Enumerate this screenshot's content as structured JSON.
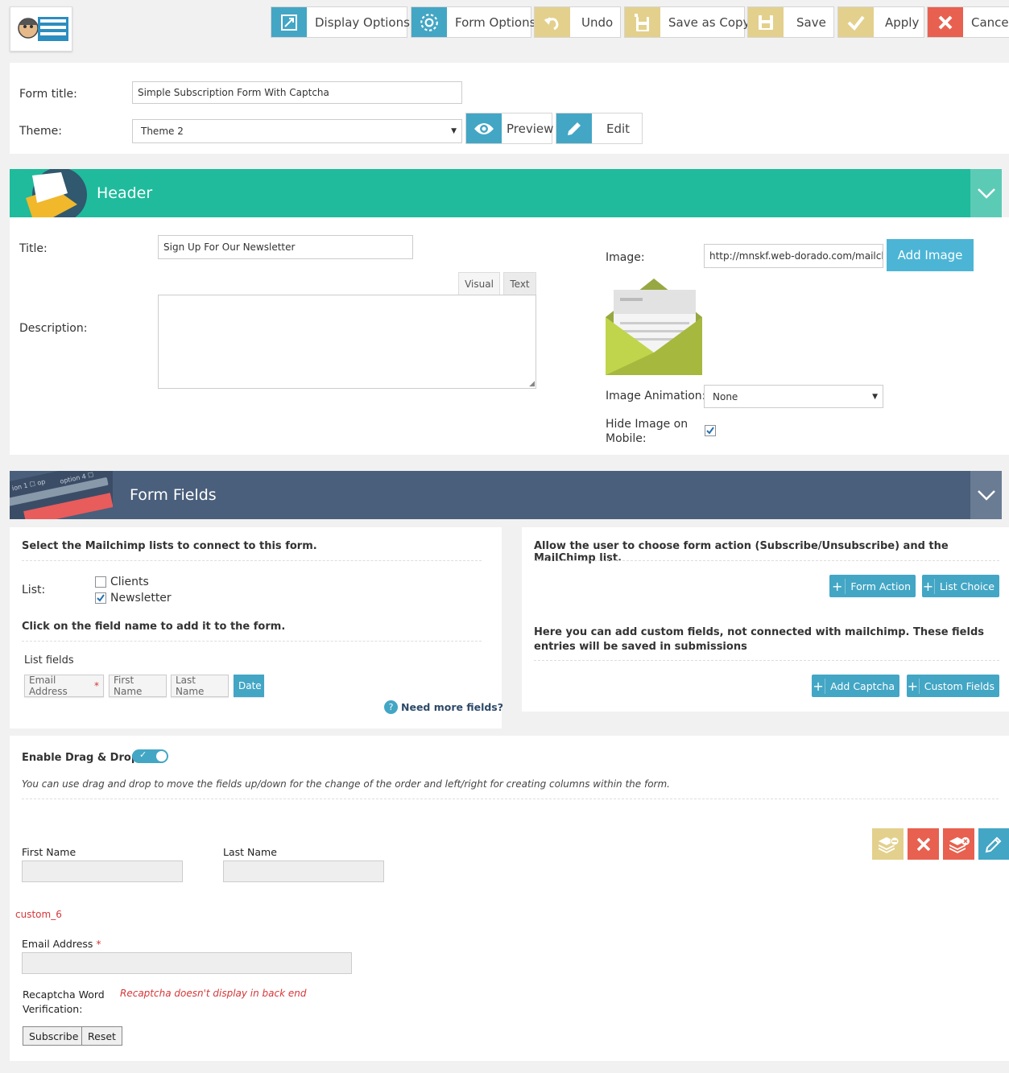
{
  "toolbar": {
    "display_options": "Display Options",
    "form_options": "Form Options",
    "undo": "Undo",
    "save_copy": "Save as Copy",
    "save": "Save",
    "apply": "Apply",
    "cancel": "Cancel"
  },
  "general": {
    "form_title_label": "Form title:",
    "form_title_value": "Simple Subscription Form With Captcha",
    "theme_label": "Theme:",
    "theme_value": "Theme 2",
    "preview": "Preview",
    "edit": "Edit"
  },
  "header_section": {
    "heading": "Header",
    "title_label": "Title:",
    "title_value": "Sign Up For Our Newsletter",
    "tab_visual": "Visual",
    "tab_text": "Text",
    "description_label": "Description:",
    "image_label": "Image:",
    "image_url": "http://mnskf.web-dorado.com/mailcl",
    "add_image": "Add Image",
    "animation_label": "Image Animation:",
    "animation_value": "None",
    "hide_label": "Hide Image on Mobile:",
    "hide_checked": true
  },
  "fields_section": {
    "heading": "Form Fields",
    "select_lists_text": "Select the Mailchimp lists to connect to this form.",
    "list_label": "List:",
    "lists": [
      {
        "name": "Clients",
        "checked": false
      },
      {
        "name": "Newsletter",
        "checked": true
      }
    ],
    "click_field_text": "Click on the field name to add it to the form.",
    "list_fields_label": "List fields",
    "chips": {
      "email": "Email Address",
      "first": "First Name",
      "last": "Last Name",
      "date": "Date"
    },
    "required_mark": "*",
    "need_more": "Need more fields?",
    "help_glyph": "?",
    "allow_user_text": "Allow the user to choose form action (Subscribe/Unsubscribe) and the MailChimp list.",
    "form_action": "Form Action",
    "list_choice": "List Choice",
    "custom_fields_text": "Here you can add custom fields, not connected with mailchimp. These fields entries will be saved in submissions",
    "add_captcha": "Add Captcha",
    "custom_fields": "Custom Fields",
    "plus": "+"
  },
  "dragdrop": {
    "enable_label": "Enable Drag & Drop",
    "enabled": true,
    "hint": "You can use drag and drop to move the fields up/down for the change of the order and left/right for creating columns within the form.",
    "first_name": "First Name",
    "last_name": "Last Name",
    "custom_label": "custom_6",
    "email": "Email Address",
    "recaptcha_label": "Recaptcha Word Verification:",
    "recaptcha_note": "Recaptcha doesn't display in back end",
    "subscribe": "Subscribe",
    "reset": "Reset"
  },
  "colors": {
    "toolbar_blue": "#43a6c5",
    "toolbar_yellow": "#e3d08c",
    "toolbar_red": "#e8604f",
    "header_teal": "#1fbb9c",
    "fields_slate": "#4a5f7b"
  }
}
